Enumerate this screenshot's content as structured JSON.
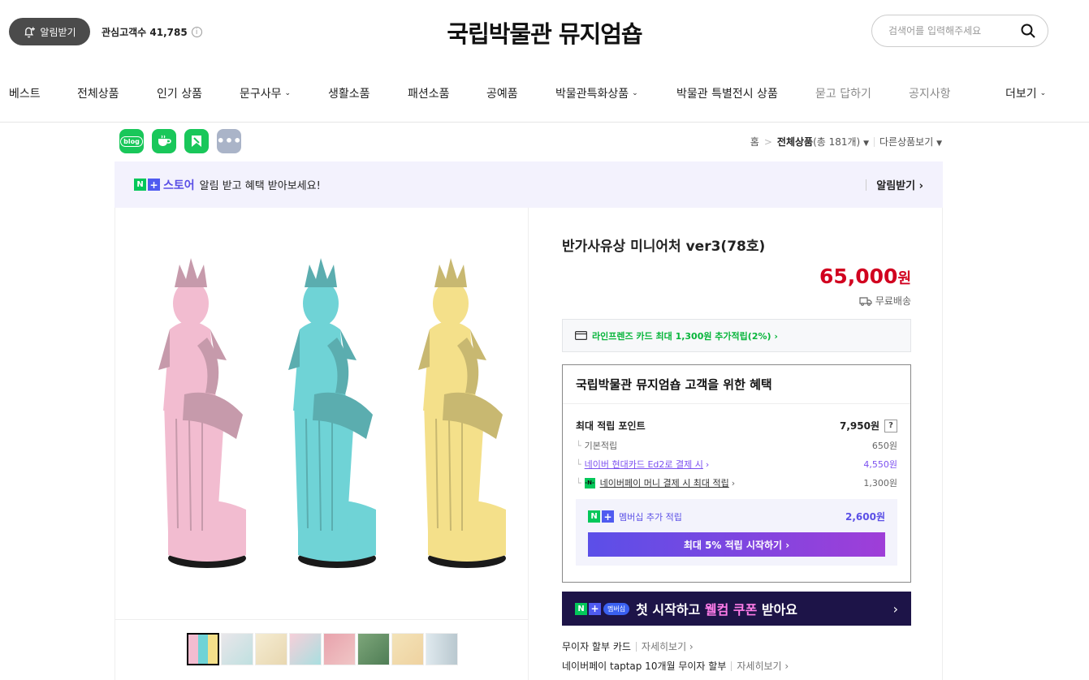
{
  "header": {
    "alarm_button": "알림받기",
    "follower_label": "관심고객수 41,785",
    "store_title": "국립박물관 뮤지엄숍",
    "search_placeholder": "검색어를 입력해주세요"
  },
  "nav": {
    "items": [
      {
        "label": "베스트"
      },
      {
        "label": "전체상품"
      },
      {
        "label": "인기 상품"
      },
      {
        "label": "문구사무"
      },
      {
        "label": "생활소품"
      },
      {
        "label": "패션소품"
      },
      {
        "label": "공예품"
      },
      {
        "label": "박물관특화상품"
      },
      {
        "label": "박물관 특별전시 상품"
      },
      {
        "label": "묻고 답하기"
      },
      {
        "label": "공지사항"
      },
      {
        "label": "더보기"
      }
    ]
  },
  "social": {
    "blog_label": "blog"
  },
  "breadcrumb": {
    "home": "홈",
    "category": "전체상품",
    "count": "(총 181개)",
    "other": "다른상품보기"
  },
  "naver_banner": {
    "n": "N",
    "plus": "+",
    "store_word": "스토어",
    "message": "알림 받고 혜택 받아보세요!",
    "action": "알림받기 ›"
  },
  "product": {
    "name": "반가사유상 미니어처 ver3(78호)",
    "price": "65,000",
    "price_unit": "원",
    "shipping": "무료배송",
    "card_promo": "라인프렌즈 카드 최대 1,300원 추가적립(2%) ›",
    "statue_colors": [
      "#f2bcd0",
      "#6fd3d6",
      "#f4e08a"
    ]
  },
  "benefit": {
    "title": "국립박물관 뮤지엄숍 고객을 위한 혜택",
    "max_point_label": "최대 적립 포인트",
    "max_point_value": "7,950원",
    "q_mark": "?",
    "tick": "└",
    "basic_label": "기본적립",
    "basic_value": "650원",
    "hyundai_label": "네이버 현대카드 Ed2로 결제 시",
    "hyundai_value": "4,550원",
    "npay_label": "네이버페이 머니 결제 시 최대 적립",
    "npay_value": "1,300원",
    "npay_badge": "-N-",
    "chevron": "›",
    "member_label": "멤버십 추가 적립",
    "member_value": "2,600원",
    "member_button": "최대 5% 적립 시작하기 ›"
  },
  "welcome_banner": {
    "pill": "멤버십",
    "text_a": "첫 시작하고 ",
    "text_b": "웰컴 쿠폰",
    "text_c": " 받아요",
    "arrow": "›"
  },
  "installments": [
    {
      "label": "무이자 할부 카드",
      "more": "자세히보기 ›"
    },
    {
      "label": "네이버페이 taptap 10개월 무이자 할부",
      "more": "자세히보기 ›"
    }
  ]
}
